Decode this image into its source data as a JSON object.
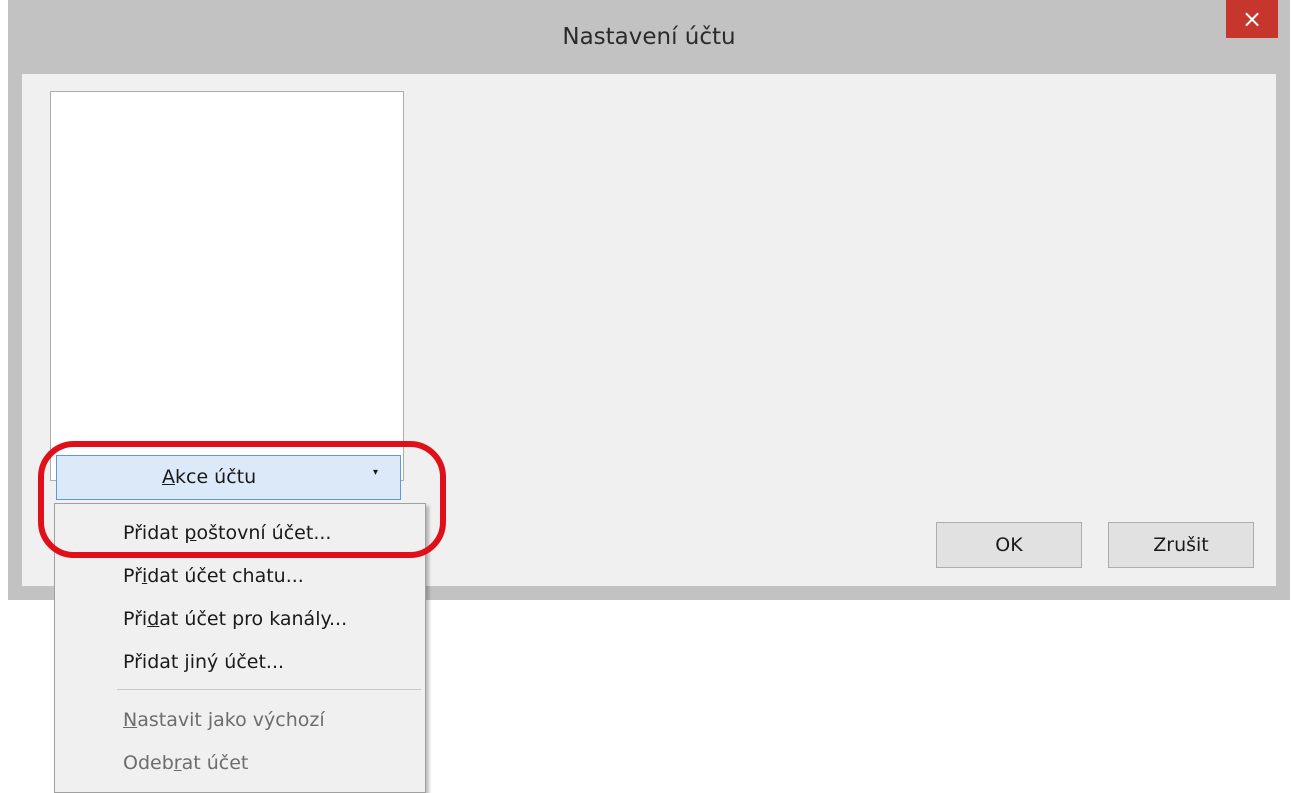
{
  "dialog": {
    "title": "Nastavení účtu",
    "close_glyph": "×"
  },
  "account_actions": {
    "label_accel": "A",
    "label_rest": "kce účtu",
    "arrow": "▾"
  },
  "menu": {
    "item1": {
      "before": "Přidat ",
      "accel": "p",
      "after": "oštovní účet..."
    },
    "item2": {
      "before": "Př",
      "accel": "i",
      "after": "dat účet chatu..."
    },
    "item3": {
      "before": "Při",
      "accel": "d",
      "after": "at účet pro kanály..."
    },
    "item4": {
      "before": "Přidat ",
      "accel": "j",
      "after": "iný účet..."
    },
    "item5": {
      "before": "",
      "accel": "N",
      "after": "astavit jako výchozí"
    },
    "item6": {
      "before": "Odeb",
      "accel": "r",
      "after": "at účet"
    }
  },
  "buttons": {
    "ok": "OK",
    "cancel": "Zrušit"
  },
  "colors": {
    "highlight": "#e0101a",
    "close_button": "#c7362d",
    "selected_button": "#dbe9f9"
  }
}
